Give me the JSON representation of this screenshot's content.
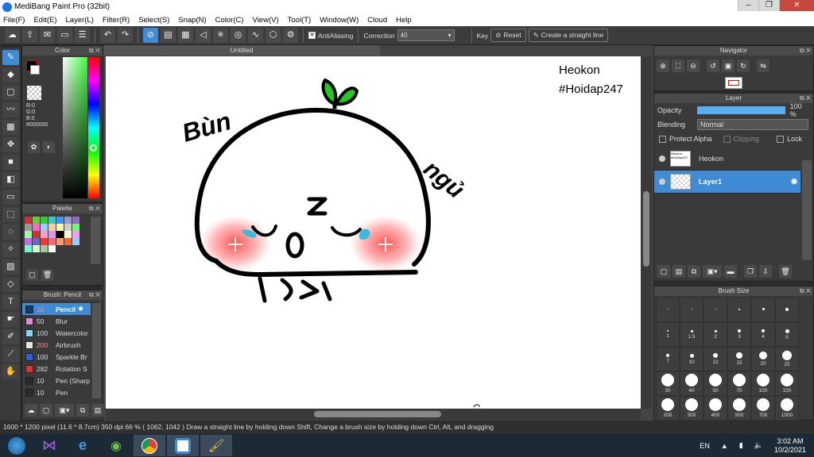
{
  "window": {
    "title": "MediBang Paint Pro (32bit)"
  },
  "menu": [
    "File(F)",
    "Edit(E)",
    "Layer(L)",
    "Filter(R)",
    "Select(S)",
    "Snap(N)",
    "Color(C)",
    "View(V)",
    "Tool(T)",
    "Window(W)",
    "Cloud",
    "Help"
  ],
  "toolbar": {
    "antialiasing": "AntiAliasing",
    "correction_label": "Correction",
    "correction_value": "40",
    "key_label": "Key",
    "reset_label": "Reset",
    "straight_line_label": "Create a straight line"
  },
  "color_panel": {
    "title": "Color",
    "r": "R:0",
    "g": "G:0",
    "b": "B:0",
    "hex": "#000000"
  },
  "palette_panel": {
    "title": "Palette"
  },
  "brush_panel": {
    "title": "Brush: Pencil",
    "items": [
      {
        "size": "10",
        "name": "Pencil",
        "color": "#1a3a66"
      },
      {
        "size": "50",
        "name": "Blur",
        "color": "#e08ad6"
      },
      {
        "size": "100",
        "name": "Watercolor",
        "color": "#7fd7f0"
      },
      {
        "size": "200",
        "name": "Airbrush",
        "color": "#e6e6e6"
      },
      {
        "size": "100",
        "name": "Sparkle Br",
        "color": "#2f5fe0"
      },
      {
        "size": "282",
        "name": "Rotation S",
        "color": "#e03030"
      },
      {
        "size": "10",
        "name": "Pen (Sharp",
        "color": "#2a2a2a"
      },
      {
        "size": "10",
        "name": "Pen",
        "color": "#2a2a2a"
      }
    ]
  },
  "canvas": {
    "tab_title": "Untitled",
    "text_heokon": "Heokon",
    "text_hashtag": "#Hoidap247",
    "text_bun": "Bùn",
    "text_ngu": "ngủ"
  },
  "navigator_panel": {
    "title": "Navigator"
  },
  "layer_panel": {
    "title": "Layer",
    "opacity_label": "Opacity",
    "opacity_value": "100 %",
    "opacity_fraction": 1.0,
    "blending_label": "Blending",
    "blending_value": "Normal",
    "protect_alpha": "Protect Alpha",
    "clipping": "Clipping",
    "lock": "Lock",
    "layers": [
      {
        "name": "Heokon",
        "thumb": "Heokon #Hoidap247"
      },
      {
        "name": "Layer1"
      }
    ]
  },
  "brush_size_panel": {
    "title": "Brush Size",
    "sizes": [
      "-",
      "-",
      "-",
      "-",
      "-",
      "-",
      "1",
      "1.5",
      "2",
      "3",
      "4",
      "5",
      "7",
      "10",
      "12",
      "15",
      "20",
      "25",
      "30",
      "40",
      "50",
      "70",
      "100",
      "150",
      "200",
      "300",
      "400",
      "500",
      "700",
      "1000"
    ]
  },
  "status": {
    "text": "1600 * 1200 pixel  (11.6 * 8.7cm)  350 dpi  66 %  ( 1062, 1042 )  Draw a straight line by holding down Shift, Change a brush size by holding down Ctrl, Alt, and dragging"
  },
  "taskbar": {
    "language": "EN",
    "time": "3:02 AM",
    "date": "10/2/2021"
  },
  "colors": {
    "accent": "#3f8bd6",
    "panel_bg": "#3a3a3a",
    "blush": "#ff6b6b",
    "leaf": "#22c922",
    "tear": "#3bbbe0"
  }
}
